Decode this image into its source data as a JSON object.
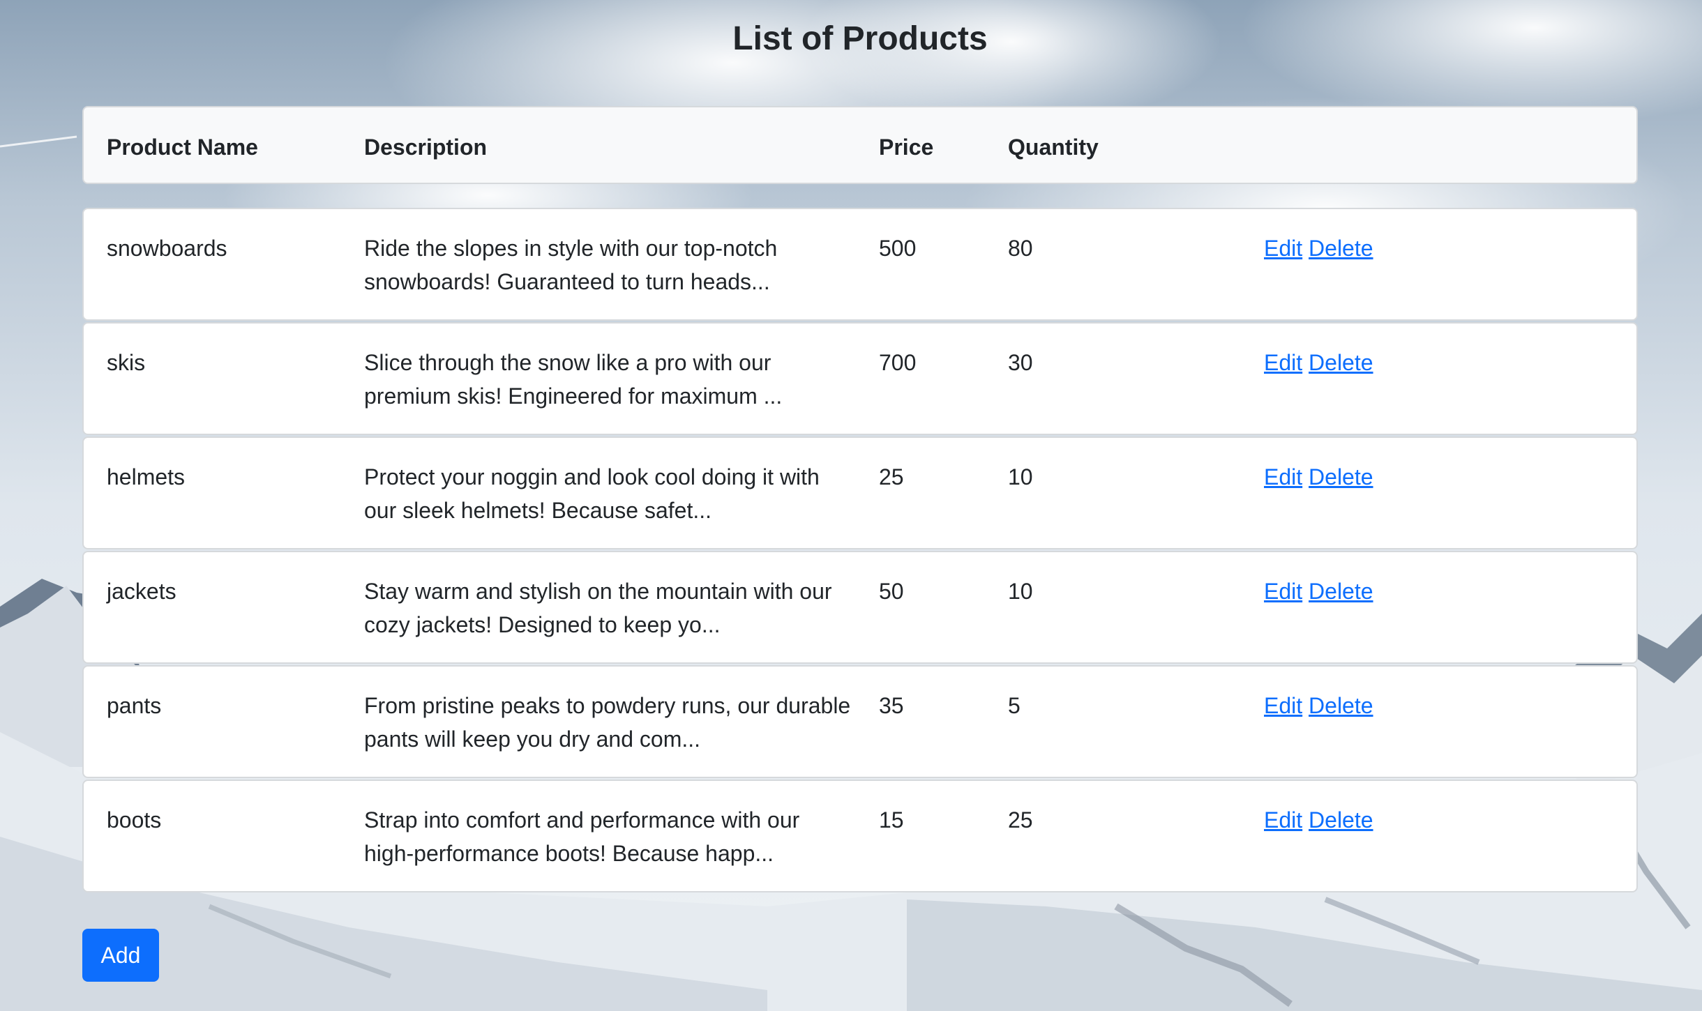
{
  "title": "List of Products",
  "table": {
    "headers": {
      "name": "Product Name",
      "description": "Description",
      "price": "Price",
      "quantity": "Quantity"
    },
    "rows": [
      {
        "name": "snowboards",
        "description": "Ride the slopes in style with our top-notch snowboards! Guaranteed to turn heads...",
        "price": "500",
        "quantity": "80",
        "edit": "Edit",
        "delete": "Delete"
      },
      {
        "name": "skis",
        "description": "Slice through the snow like a pro with our premium skis! Engineered for maximum ...",
        "price": "700",
        "quantity": "30",
        "edit": "Edit",
        "delete": "Delete"
      },
      {
        "name": "helmets",
        "description": "Protect your noggin and look cool doing it with our sleek helmets! Because safet...",
        "price": "25",
        "quantity": "10",
        "edit": "Edit",
        "delete": "Delete"
      },
      {
        "name": "jackets",
        "description": "Stay warm and stylish on the mountain with our cozy jackets! Designed to keep yo...",
        "price": "50",
        "quantity": "10",
        "edit": "Edit",
        "delete": "Delete"
      },
      {
        "name": "pants",
        "description": "From pristine peaks to powdery runs, our durable pants will keep you dry and com...",
        "price": "35",
        "quantity": "5",
        "edit": "Edit",
        "delete": "Delete"
      },
      {
        "name": "boots",
        "description": "Strap into comfort and performance with our high-performance boots! Because happ...",
        "price": "15",
        "quantity": "25",
        "edit": "Edit",
        "delete": "Delete"
      }
    ]
  },
  "add_button": "Add",
  "colors": {
    "link": "#0d6efd",
    "button": "#0d6efd",
    "header_bg": "#f8f9fa",
    "row_bg": "#ffffff"
  }
}
